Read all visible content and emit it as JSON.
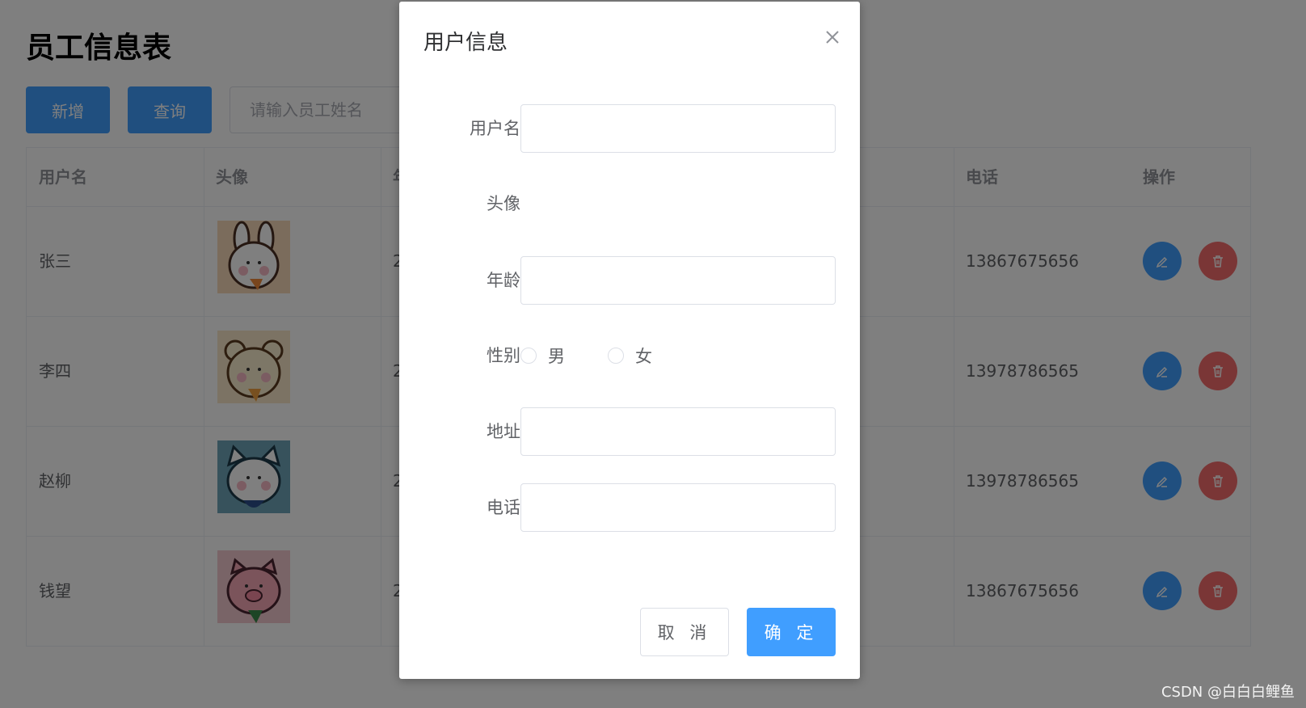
{
  "page": {
    "title": "员工信息表",
    "add_button": "新增",
    "query_button": "查询",
    "search_placeholder": "请输入员工姓名"
  },
  "table": {
    "headers": {
      "username": "用户名",
      "avatar": "头像",
      "age_partial": "年",
      "phone": "电话",
      "actions": "操作"
    },
    "rows": [
      {
        "name": "张三",
        "age_partial": "2",
        "phone": "13867675656"
      },
      {
        "name": "李四",
        "age_partial": "2",
        "phone": "13978786565"
      },
      {
        "name": "赵柳",
        "age_partial": "2",
        "phone": "13978786565"
      },
      {
        "name": "钱望",
        "age_partial": "2",
        "phone": "13867675656"
      }
    ]
  },
  "pagination": {
    "prev": "‹",
    "next": "›"
  },
  "watermark": "CSDN @白白白鲤鱼",
  "dialog": {
    "title": "用户信息",
    "labels": {
      "username": "用户名",
      "avatar": "头像",
      "age": "年龄",
      "gender": "性别",
      "address": "地址",
      "phone": "电话"
    },
    "gender_options": {
      "male": "男",
      "female": "女"
    },
    "cancel": "取 消",
    "confirm": "确 定"
  },
  "colors": {
    "primary": "#409eff",
    "danger": "#f56c6c",
    "overlay": "rgba(0,0,0,0.5)"
  },
  "icons": [
    "edit-icon",
    "delete-icon",
    "close-icon",
    "avatar-rabbit",
    "avatar-bear",
    "avatar-cat",
    "avatar-pig"
  ]
}
